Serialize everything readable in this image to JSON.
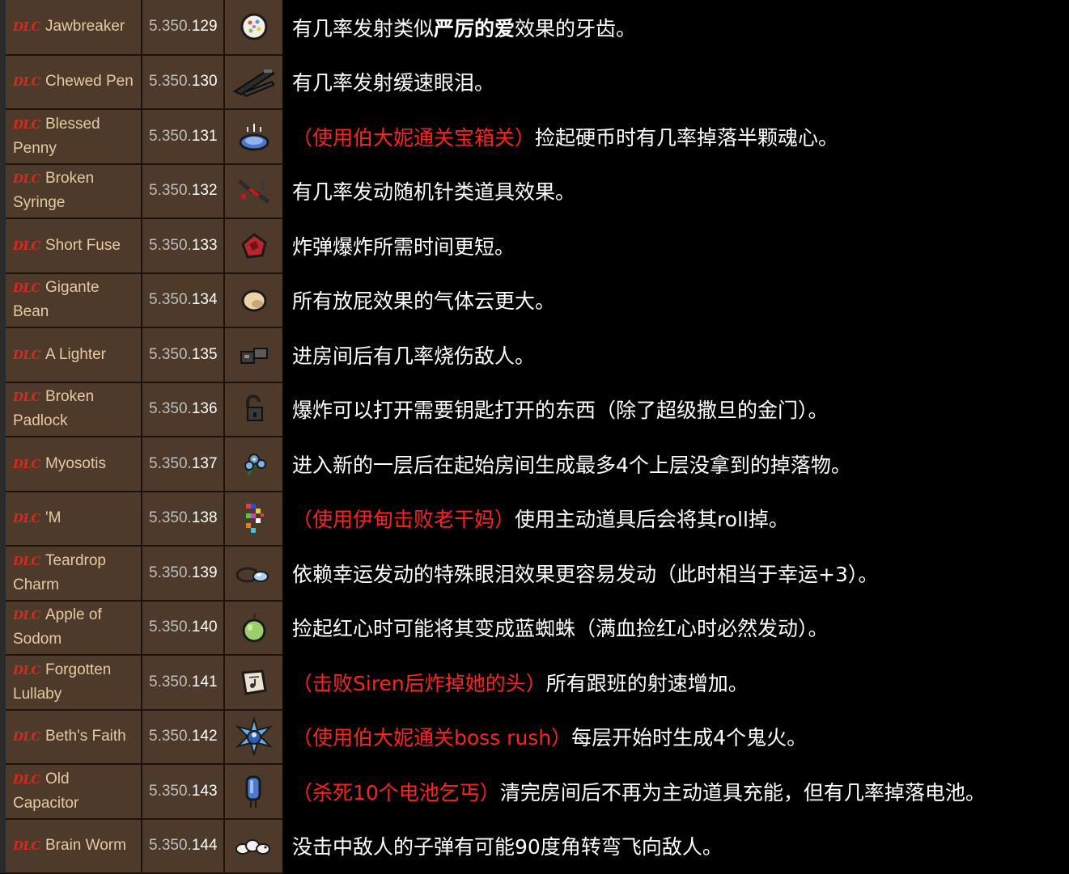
{
  "dlc_badge": "DLC",
  "items": [
    {
      "name": "Jawbreaker",
      "id_prefix": "5.350.",
      "id_num": "129",
      "icon": "jawbreaker-icon",
      "desc_1": "有几率发射类似",
      "desc_bold": "严厉的爱",
      "desc_2": "效果的牙齿。"
    },
    {
      "name": "Chewed Pen",
      "id_prefix": "5.350.",
      "id_num": "130",
      "icon": "chewed-pen-icon",
      "desc": "有几率发射缓速眼泪。"
    },
    {
      "name": "Blessed Penny",
      "id_prefix": "5.350.",
      "id_num": "131",
      "icon": "blessed-penny-icon",
      "req": "（使用伯大妮通关宝箱关）",
      "desc": "捡起硬币时有几率掉落半颗魂心。"
    },
    {
      "name": "Broken Syringe",
      "id_prefix": "5.350.",
      "id_num": "132",
      "icon": "broken-syringe-icon",
      "desc": "有几率发动随机针类道具效果。"
    },
    {
      "name": "Short Fuse",
      "id_prefix": "5.350.",
      "id_num": "133",
      "icon": "short-fuse-icon",
      "desc": "炸弹爆炸所需时间更短。"
    },
    {
      "name": "Gigante Bean",
      "id_prefix": "5.350.",
      "id_num": "134",
      "icon": "gigante-bean-icon",
      "desc": "所有放屁效果的气体云更大。"
    },
    {
      "name": "A Lighter",
      "id_prefix": "5.350.",
      "id_num": "135",
      "icon": "lighter-icon",
      "desc": "进房间后有几率烧伤敌人。"
    },
    {
      "name": "Broken Padlock",
      "id_prefix": "5.350.",
      "id_num": "136",
      "icon": "broken-padlock-icon",
      "desc": "爆炸可以打开需要钥匙打开的东西（除了超级撒旦的金门）。"
    },
    {
      "name": "Myosotis",
      "id_prefix": "5.350.",
      "id_num": "137",
      "icon": "myosotis-icon",
      "desc": "进入新的一层后在起始房间生成最多4个上层没拿到的掉落物。"
    },
    {
      "name": "'M",
      "id_prefix": "5.350.",
      "id_num": "138",
      "icon": "glitch-m-icon",
      "req": "（使用伊甸击败老干妈）",
      "desc": "使用主动道具后会将其roll掉。"
    },
    {
      "name": "Teardrop Charm",
      "id_prefix": "5.350.",
      "id_num": "139",
      "icon": "teardrop-charm-icon",
      "desc": "依赖幸运发动的特殊眼泪效果更容易发动（此时相当于幸运+3）。"
    },
    {
      "name": "Apple of Sodom",
      "id_prefix": "5.350.",
      "id_num": "140",
      "icon": "apple-of-sodom-icon",
      "desc": "捡起红心时可能将其变成蓝蜘蛛（满血捡红心时必然发动）。"
    },
    {
      "name": "Forgotten Lullaby",
      "id_prefix": "5.350.",
      "id_num": "141",
      "icon": "forgotten-lullaby-icon",
      "req": "（击败Siren后炸掉她的头）",
      "desc": "所有跟班的射速增加。"
    },
    {
      "name": "Beth's Faith",
      "id_prefix": "5.350.",
      "id_num": "142",
      "icon": "beths-faith-icon",
      "req": "（使用伯大妮通关boss rush）",
      "desc": "每层开始时生成4个鬼火。"
    },
    {
      "name": "Old Capacitor",
      "id_prefix": "5.350.",
      "id_num": "143",
      "icon": "old-capacitor-icon",
      "req": "（杀死10个电池乞丐）",
      "desc": "清完房间后不再为主动道具充能，但有几率掉落电池。"
    },
    {
      "name": "Brain Worm",
      "id_prefix": "5.350.",
      "id_num": "144",
      "icon": "brain-worm-icon",
      "desc": "没击中敌人的子弹有可能90度角转弯飞向敌人。"
    }
  ]
}
